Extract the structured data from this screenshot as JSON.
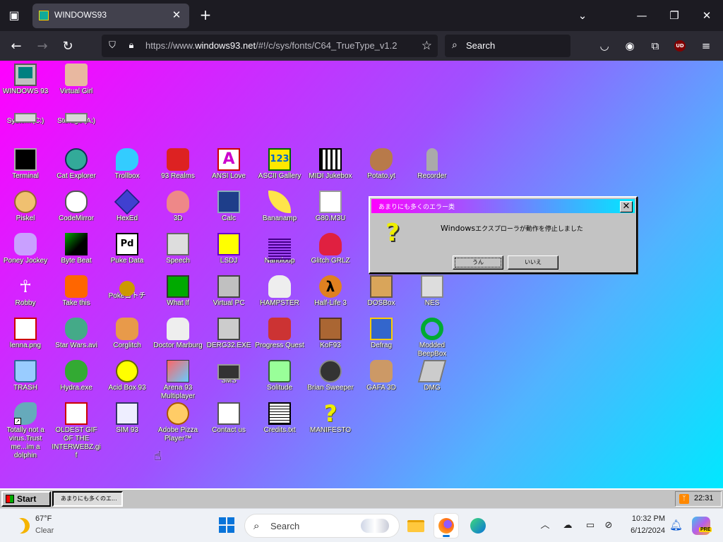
{
  "browser": {
    "tab_title": "WINDOWS93",
    "tab_close": "✕",
    "new_tab": "+",
    "url_scheme": "https://www.",
    "url_host": "windows93.net",
    "url_path": "/#!/c/sys/fonts/C64_TrueType_v1.2",
    "search_placeholder": "Search",
    "ublock_badge": "UD"
  },
  "desktop": {
    "icons": [
      {
        "label": "WINDOWS 93",
        "icon": "monitor-icon"
      },
      {
        "label": "Virtual Girl",
        "icon": "face-icon"
      },
      {
        "label": "System (C:)",
        "icon": "hard-drive-icon"
      },
      {
        "label": "Storage (A:)",
        "icon": "floppy-drive-icon"
      },
      {
        "label": "Terminal",
        "icon": "terminal-icon"
      },
      {
        "label": "Cat Explorer",
        "icon": "globe-icon"
      },
      {
        "label": "Trollbox",
        "icon": "chat-bubble-icon"
      },
      {
        "label": "93 Realms",
        "icon": "red-character-icon"
      },
      {
        "label": "ANSI Love",
        "icon": "ansi-icon",
        "glyph": "A"
      },
      {
        "label": "ASCII Gallery",
        "icon": "ascii-123-icon",
        "glyph": "123"
      },
      {
        "label": "MIDI Jukebox",
        "icon": "piano-keys-icon"
      },
      {
        "label": "Potato.yt",
        "icon": "potato-icon"
      },
      {
        "label": "Recorder",
        "icon": "microphone-icon"
      },
      {
        "label": "Piskel",
        "icon": "paint-palette-icon"
      },
      {
        "label": "CodeMirror",
        "icon": "mouse-icon"
      },
      {
        "label": "HexEd",
        "icon": "cube-icon"
      },
      {
        "label": "3D",
        "icon": "teapot-icon"
      },
      {
        "label": "Calc",
        "icon": "calculator-icon"
      },
      {
        "label": "Bananamp",
        "icon": "banana-icon"
      },
      {
        "label": "G80.M3U",
        "icon": "speaker-icon"
      },
      {
        "label": "Poney Jockey",
        "icon": "pony-icon"
      },
      {
        "label": "Byte Beat",
        "icon": "byte-beat-icon"
      },
      {
        "label": "Puke Data",
        "icon": "pd-icon",
        "glyph": "Pd"
      },
      {
        "label": "Speech",
        "icon": "speech-face-icon"
      },
      {
        "label": "LSDJ",
        "icon": "lsdj-icon"
      },
      {
        "label": "Nanoloop",
        "icon": "wave-icon"
      },
      {
        "label": "Glitch GRLZ",
        "icon": "lips-icon"
      },
      {
        "label": "Robby",
        "icon": "stick-figure-icon",
        "glyph": "☥"
      },
      {
        "label": "Take this",
        "icon": "take-this-icon"
      },
      {
        "label": "Pokeゴトチ",
        "icon": "pokeball-icon"
      },
      {
        "label": "What If",
        "icon": "what-if-icon"
      },
      {
        "label": "Virtual PC",
        "icon": "virtual-pc-icon"
      },
      {
        "label": "HAMPSTER",
        "icon": "owl-icon"
      },
      {
        "label": "Half-Life 3",
        "icon": "half-life-icon",
        "glyph": "λ"
      },
      {
        "label": "DOSBox",
        "icon": "dosbox-icon"
      },
      {
        "label": "NES",
        "icon": "nes-icon"
      },
      {
        "label": "lenna.png",
        "icon": "image-file-icon"
      },
      {
        "label": "Star Wars.avi",
        "icon": "yoda-icon"
      },
      {
        "label": "Corglitch",
        "icon": "corgi-icon"
      },
      {
        "label": "Doctor Marburg",
        "icon": "doctor-icon"
      },
      {
        "label": "DERG32.EXE",
        "icon": "derg-icon"
      },
      {
        "label": "Progress Quest",
        "icon": "progress-quest-icon"
      },
      {
        "label": "KoF93",
        "icon": "fighter-icon"
      },
      {
        "label": "Defrag",
        "icon": "defrag-icon"
      },
      {
        "label": "Modded BeepBox",
        "icon": "green-ring-icon"
      },
      {
        "label": "TRASH",
        "icon": "trash-icon"
      },
      {
        "label": "Hydra.exe",
        "icon": "hydra-icon"
      },
      {
        "label": "Acid Box 93",
        "icon": "smiley-icon"
      },
      {
        "label": "Arena 93 Multiplayer",
        "icon": "box-3d-icon"
      },
      {
        "label": "SMS",
        "icon": "sms-console-icon"
      },
      {
        "label": "Solitude",
        "icon": "jar-icon"
      },
      {
        "label": "Brian Sweeper",
        "icon": "mine-icon"
      },
      {
        "label": "GAFA 3D",
        "icon": "gafa-icon"
      },
      {
        "label": "DMG",
        "icon": "dmg-icon"
      },
      {
        "label": "Totally not a virus.Trust me...im a dolphin",
        "icon": "dolphin-icon"
      },
      {
        "label": "OLDEST GIF OF THE INTERWEBZ.gif",
        "icon": "gif-file-icon"
      },
      {
        "label": "SIM 93",
        "icon": "sim-icon"
      },
      {
        "label": "Adobe Pizza Player™",
        "icon": "pizza-icon"
      },
      {
        "label": "Contact us",
        "icon": "contact-icon"
      },
      {
        "label": "Credits.txt",
        "icon": "text-file-icon"
      },
      {
        "label": "MANIFESTO",
        "icon": "question-mark-icon",
        "glyph": "?"
      }
    ]
  },
  "dialog": {
    "title": "あまりにも多くのエラー类",
    "message_prefix": "Windows",
    "message_rest": "エクスプローラが動作を停止しました",
    "yes_button": "うん",
    "no_button": "いいえ",
    "close_glyph": "✕"
  },
  "w93_taskbar": {
    "start_label": "Start",
    "task_label": "あまりにも多くのエ...",
    "clock": "22:31"
  },
  "windows_taskbar": {
    "weather_temp": "67°F",
    "weather_desc": "Clear",
    "search_placeholder": "Search",
    "time": "10:32 PM",
    "date": "6/12/2024",
    "copilot_badge": "PRE"
  }
}
